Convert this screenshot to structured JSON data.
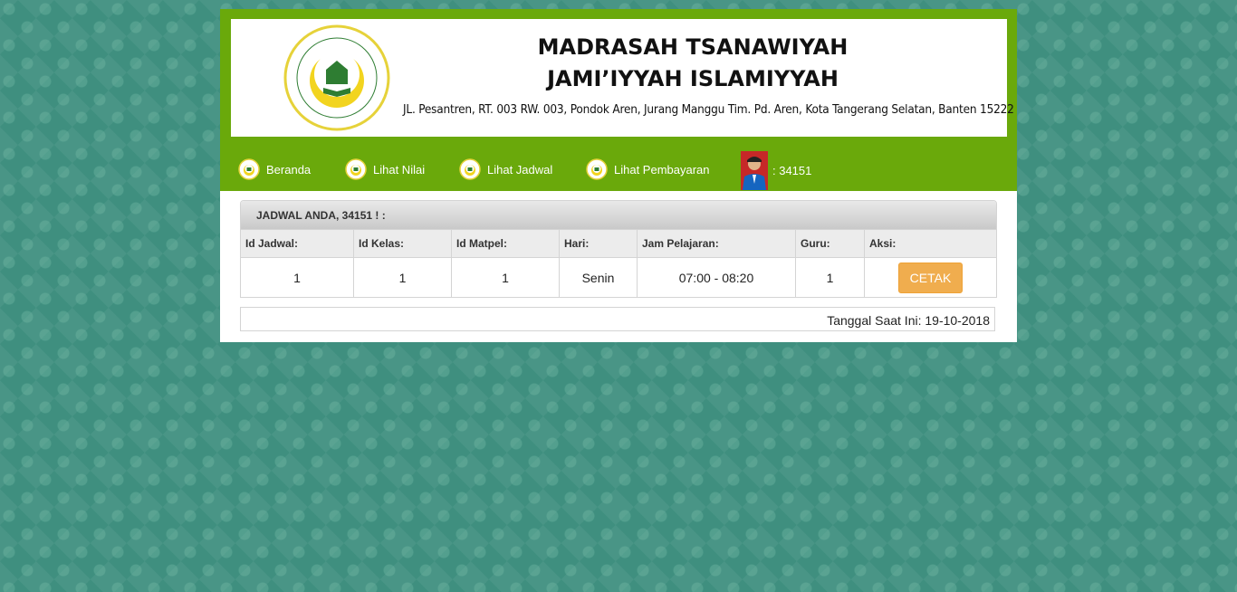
{
  "header": {
    "title_line1": "MADRASAH TSANAWIYAH",
    "title_line2": "JAMI’IYYAH ISLAMIYYAH",
    "address": "JL. Pesantren, RT. 003 RW. 003, Pondok Aren, Jurang Manggu Tim. Pd. Aren, Kota Tangerang Selatan, Banten 15222",
    "logo_icon": "school-crest-icon"
  },
  "nav": {
    "items": [
      {
        "label": "Beranda",
        "icon": "crest-icon"
      },
      {
        "label": "Lihat Nilai",
        "icon": "crest-icon"
      },
      {
        "label": "Lihat Jadwal",
        "icon": "crest-icon"
      },
      {
        "label": "Lihat Pembayaran",
        "icon": "crest-icon"
      }
    ],
    "user_id": ":  34151"
  },
  "panel": {
    "heading": "JADWAL ANDA, 34151 ! :",
    "columns": [
      "Id Jadwal:",
      "Id Kelas:",
      "Id Matpel:",
      "Hari:",
      "Jam Pelajaran:",
      "Guru:",
      "Aksi:"
    ],
    "rows": [
      {
        "id_jadwal": "1",
        "id_kelas": "1",
        "id_matpel": "1",
        "hari": "Senin",
        "jam": "07:00 - 08:20",
        "guru": "1",
        "aksi": "CETAK"
      }
    ]
  },
  "footer": {
    "date_text": "Tanggal Saat Ini: 19-10-2018"
  },
  "colors": {
    "nav_green": "#6aa90b",
    "button_orange": "#f0ad4e",
    "background_teal": "#3f8f7f"
  }
}
